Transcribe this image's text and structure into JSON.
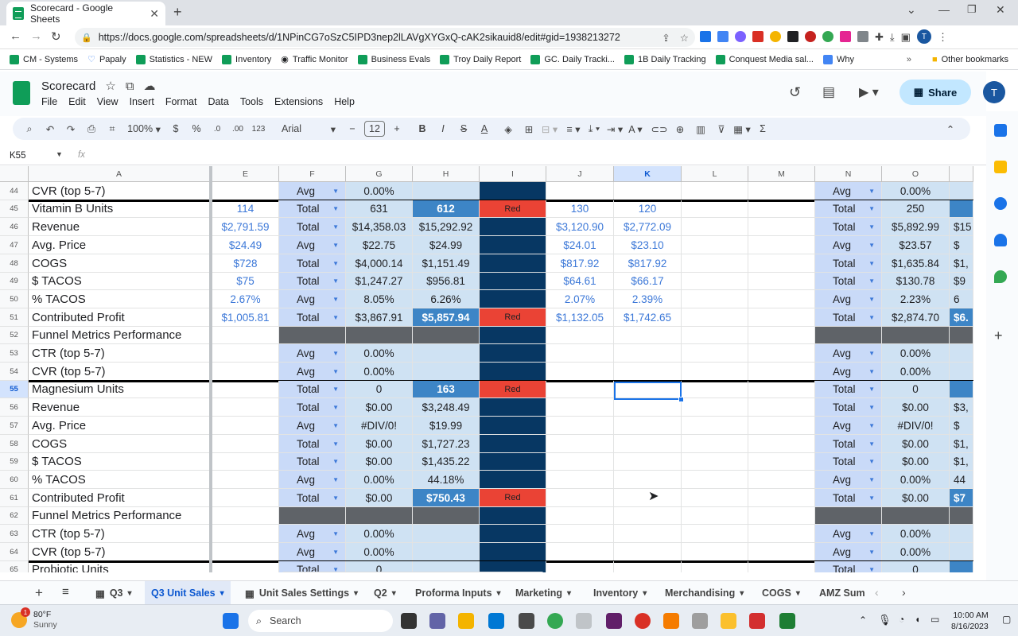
{
  "browser": {
    "tab_title": "Scorecard - Google Sheets",
    "url": "https://docs.google.com/spreadsheets/d/1NPinCG7oSzC5IPD3nep2lLAVgXYGxQ-cAK2sikauid8/edit#gid=1938213272",
    "bookmarks": [
      "CM - Systems",
      "Papaly",
      "Statistics - NEW",
      "Inventory",
      "Traffic Monitor",
      "Business Evals",
      "Troy Daily Report",
      "GC. Daily Tracki...",
      "1B Daily Tracking",
      "Conquest Media sal...",
      "Why"
    ],
    "other_bookmarks": "Other bookmarks",
    "profile_initial": "T",
    "chevron": "»"
  },
  "app": {
    "doc_title": "Scorecard",
    "menu": [
      "File",
      "Edit",
      "View",
      "Insert",
      "Format",
      "Data",
      "Tools",
      "Extensions",
      "Help"
    ],
    "share_label": "Share",
    "avatar_initial": "T"
  },
  "toolbar": {
    "zoom": "100%",
    "currency": "$",
    "percent": "%",
    "dec_less": ".0",
    "dec_more": ".00",
    "number_format": "123",
    "font": "Arial",
    "font_size": "12"
  },
  "formula_bar": {
    "cell_ref": "K55",
    "fx": "fx",
    "content": ""
  },
  "columns": [
    "A",
    "E",
    "F",
    "G",
    "H",
    "I",
    "J",
    "K",
    "L",
    "M",
    "N",
    "O",
    ""
  ],
  "rows": [
    {
      "n": "44",
      "a": "CVR (top 5-7)",
      "e": "",
      "f": "Avg",
      "g": "0.00%",
      "h": "",
      "i": "",
      "j": "",
      "k": "",
      "n_col": "Avg",
      "o": "0.00%",
      "p": ""
    },
    {
      "n": "45",
      "a": "Vitamin B Units",
      "e": "114",
      "f": "Total",
      "g": "631",
      "h": "612",
      "i": "Red",
      "j": "130",
      "k": "120",
      "n_col": "Total",
      "o": "250",
      "p": ""
    },
    {
      "n": "46",
      "a": "Revenue",
      "e": "$2,791.59",
      "f": "Total",
      "g": "$14,358.03",
      "h": "$15,292.92",
      "i": "",
      "j": "$3,120.90",
      "k": "$2,772.09",
      "n_col": "Total",
      "o": "$5,892.99",
      "p": "$15"
    },
    {
      "n": "47",
      "a": "Avg. Price",
      "e": "$24.49",
      "f": "Avg",
      "g": "$22.75",
      "h": "$24.99",
      "i": "",
      "j": "$24.01",
      "k": "$23.10",
      "n_col": "Avg",
      "o": "$23.57",
      "p": "$"
    },
    {
      "n": "48",
      "a": "COGS",
      "e": "$728",
      "f": "Total",
      "g": "$4,000.14",
      "h": "$1,151.49",
      "i": "",
      "j": "$817.92",
      "k": "$817.92",
      "n_col": "Total",
      "o": "$1,635.84",
      "p": "$1,"
    },
    {
      "n": "49",
      "a": "$ TACOS",
      "e": "$75",
      "f": "Total",
      "g": "$1,247.27",
      "h": "$956.81",
      "i": "",
      "j": "$64.61",
      "k": "$66.17",
      "n_col": "Total",
      "o": "$130.78",
      "p": "$9"
    },
    {
      "n": "50",
      "a": "% TACOS",
      "e": "2.67%",
      "f": "Avg",
      "g": "8.05%",
      "h": "6.26%",
      "i": "",
      "j": "2.07%",
      "k": "2.39%",
      "n_col": "Avg",
      "o": "2.23%",
      "p": "6"
    },
    {
      "n": "51",
      "a": "Contributed Profit",
      "e": "$1,005.81",
      "f": "Total",
      "g": "$3,867.91",
      "h": "$5,857.94",
      "i": "Red",
      "j": "$1,132.05",
      "k": "$1,742.65",
      "n_col": "Total",
      "o": "$2,874.70",
      "p": "$6."
    },
    {
      "n": "52",
      "a": "Funnel Metrics Performance",
      "e": "",
      "f": "",
      "g": "",
      "h": "",
      "i": "",
      "j": "",
      "k": "",
      "n_col": "",
      "o": "",
      "p": ""
    },
    {
      "n": "53",
      "a": "CTR (top 5-7)",
      "e": "",
      "f": "Avg",
      "g": "0.00%",
      "h": "",
      "i": "",
      "j": "",
      "k": "",
      "n_col": "Avg",
      "o": "0.00%",
      "p": ""
    },
    {
      "n": "54",
      "a": "CVR (top 5-7)",
      "e": "",
      "f": "Avg",
      "g": "0.00%",
      "h": "",
      "i": "",
      "j": "",
      "k": "",
      "n_col": "Avg",
      "o": "0.00%",
      "p": ""
    },
    {
      "n": "55",
      "a": "Magnesium Units",
      "e": "",
      "f": "Total",
      "g": "0",
      "h": "163",
      "i": "Red",
      "j": "",
      "k": "",
      "n_col": "Total",
      "o": "0",
      "p": ""
    },
    {
      "n": "56",
      "a": "Revenue",
      "e": "",
      "f": "Total",
      "g": "$0.00",
      "h": "$3,248.49",
      "i": "",
      "j": "",
      "k": "",
      "n_col": "Total",
      "o": "$0.00",
      "p": "$3,"
    },
    {
      "n": "57",
      "a": "Avg. Price",
      "e": "",
      "f": "Avg",
      "g": "#DIV/0!",
      "h": "$19.99",
      "i": "",
      "j": "",
      "k": "",
      "n_col": "Avg",
      "o": "#DIV/0!",
      "p": "$"
    },
    {
      "n": "58",
      "a": "COGS",
      "e": "",
      "f": "Total",
      "g": "$0.00",
      "h": "$1,727.23",
      "i": "",
      "j": "",
      "k": "",
      "n_col": "Total",
      "o": "$0.00",
      "p": "$1,"
    },
    {
      "n": "59",
      "a": "$ TACOS",
      "e": "",
      "f": "Total",
      "g": "$0.00",
      "h": "$1,435.22",
      "i": "",
      "j": "",
      "k": "",
      "n_col": "Total",
      "o": "$0.00",
      "p": "$1,"
    },
    {
      "n": "60",
      "a": "% TACOS",
      "e": "",
      "f": "Avg",
      "g": "0.00%",
      "h": "44.18%",
      "i": "",
      "j": "",
      "k": "",
      "n_col": "Avg",
      "o": "0.00%",
      "p": "44"
    },
    {
      "n": "61",
      "a": "Contributed Profit",
      "e": "",
      "f": "Total",
      "g": "$0.00",
      "h": "$750.43",
      "i": "Red",
      "j": "",
      "k": "",
      "n_col": "Total",
      "o": "$0.00",
      "p": "$7"
    },
    {
      "n": "62",
      "a": "Funnel Metrics Performance",
      "e": "",
      "f": "",
      "g": "",
      "h": "",
      "i": "",
      "j": "",
      "k": "",
      "n_col": "",
      "o": "",
      "p": ""
    },
    {
      "n": "63",
      "a": "CTR (top 5-7)",
      "e": "",
      "f": "Avg",
      "g": "0.00%",
      "h": "",
      "i": "",
      "j": "",
      "k": "",
      "n_col": "Avg",
      "o": "0.00%",
      "p": ""
    },
    {
      "n": "64",
      "a": "CVR (top 5-7)",
      "e": "",
      "f": "Avg",
      "g": "0.00%",
      "h": "",
      "i": "",
      "j": "",
      "k": "",
      "n_col": "Avg",
      "o": "0.00%",
      "p": ""
    },
    {
      "n": "65",
      "a": "Probiotic Units",
      "e": "",
      "f": "Total",
      "g": "0",
      "h": "",
      "i": "",
      "j": "",
      "k": "",
      "n_col": "Total",
      "o": "0",
      "p": ""
    }
  ],
  "sheet_tabs": [
    {
      "label": "Q3",
      "icon": true,
      "active": false
    },
    {
      "label": "Q3 Unit Sales",
      "icon": false,
      "active": true
    },
    {
      "label": "Unit Sales Settings",
      "icon": true,
      "active": false
    },
    {
      "label": "Q2",
      "icon": false,
      "active": false
    },
    {
      "label": "Proforma Inputs",
      "icon": false,
      "active": false
    },
    {
      "label": "Marketing",
      "icon": false,
      "active": false
    },
    {
      "label": "Inventory",
      "icon": false,
      "active": false
    },
    {
      "label": "Merchandising",
      "icon": false,
      "active": false
    },
    {
      "label": "COGS",
      "icon": false,
      "active": false
    },
    {
      "label": "AMZ Sum",
      "icon": false,
      "active": false
    }
  ],
  "taskbar": {
    "weather_temp": "80°F",
    "weather_desc": "Sunny",
    "weather_badge": "1",
    "search_placeholder": "Search",
    "time": "10:00 AM",
    "date": "8/16/2023"
  }
}
